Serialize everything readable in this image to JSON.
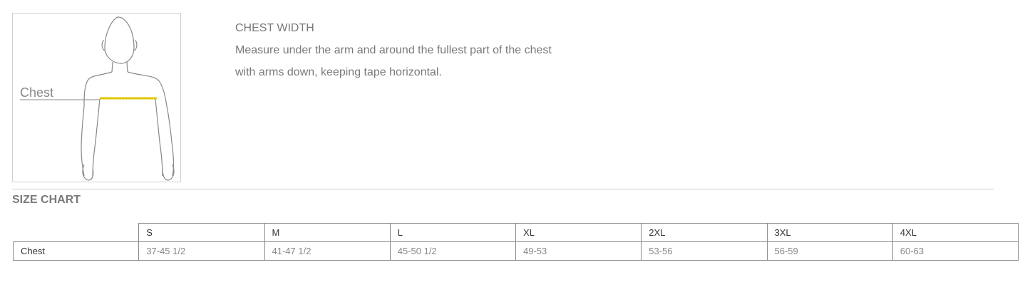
{
  "figure": {
    "label": "Chest",
    "alt": "body outline showing chest measurement"
  },
  "description": {
    "heading": "CHEST WIDTH",
    "line1": "Measure under the arm and around the fullest part of the chest",
    "line2": "with arms down, keeping tape horizontal."
  },
  "size_chart": {
    "title": "SIZE CHART",
    "sizes": [
      "S",
      "M",
      "L",
      "XL",
      "2XL",
      "3XL",
      "4XL"
    ],
    "rows": [
      {
        "label": "Chest",
        "values": [
          "37-45 1/2",
          "41-47 1/2",
          "45-50 1/2",
          "49-53",
          "53-56",
          "56-59",
          "60-63"
        ]
      }
    ]
  },
  "colors": {
    "text": "#777777",
    "border": "#8a8a8a",
    "tape": "#e8d000"
  }
}
